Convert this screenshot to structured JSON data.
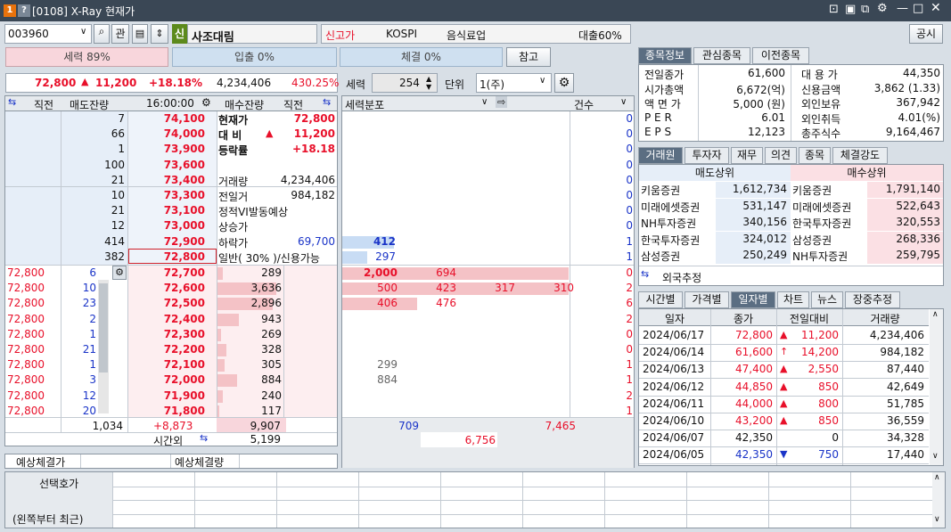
{
  "window": {
    "badge1": "1",
    "badge2": "?",
    "title": "[0108] X-Ray 현재가"
  },
  "toolbar": {
    "code": "003960",
    "gwan": "관",
    "sin": "신",
    "name": "사조대림",
    "flag": "신고가",
    "market": "KOSPI",
    "sector": "음식료업",
    "loan": "대출60%",
    "notice": "공시"
  },
  "strength": {
    "power": "세력 89%",
    "inflow": "입출 0%",
    "exec": "체결 0%",
    "ref": "참고"
  },
  "price_line": {
    "price": "72,800",
    "change": "11,200",
    "rate": "+18.18%",
    "volume": "4,234,406",
    "pct": "430.25%"
  },
  "hoga_head": {
    "c1": "직전",
    "c2": "매도잔량",
    "time": "16:00:00",
    "c4": "매수잔량",
    "c5": "직전"
  },
  "ask": [
    {
      "qty": "7",
      "price": "74,100"
    },
    {
      "qty": "66",
      "price": "74,000"
    },
    {
      "qty": "1",
      "price": "73,900"
    },
    {
      "qty": "100",
      "price": "73,600"
    },
    {
      "qty": "21",
      "price": "73,400"
    },
    {
      "qty": "10",
      "price": "73,300"
    },
    {
      "qty": "21",
      "price": "73,100"
    },
    {
      "qty": "12",
      "price": "73,000"
    },
    {
      "qty": "414",
      "price": "72,900"
    },
    {
      "qty": "382",
      "price": "72,800"
    }
  ],
  "info": [
    {
      "k": "현재가",
      "v": "72,800"
    },
    {
      "k": "대 비",
      "v": "11,200"
    },
    {
      "k": "등락률",
      "v": "+18.18"
    },
    {
      "k": "",
      "v": ""
    },
    {
      "k": "거래량",
      "v": "4,234,406"
    },
    {
      "k": "전일거",
      "v": "984,182"
    },
    {
      "k": "정적VI발동예상",
      "v": ""
    },
    {
      "k": "상승가",
      "v": ""
    },
    {
      "k": "하락가",
      "v": "69,700"
    },
    {
      "k": "일반( 30% )/신용가능",
      "v": ""
    }
  ],
  "bid": [
    {
      "prev": "72,800",
      "exec": "6",
      "price": "72,700",
      "qty": "289"
    },
    {
      "prev": "72,800",
      "exec": "10",
      "price": "72,600",
      "qty": "3,636"
    },
    {
      "prev": "72,800",
      "exec": "23",
      "price": "72,500",
      "qty": "2,896"
    },
    {
      "prev": "72,800",
      "exec": "2",
      "price": "72,400",
      "qty": "943"
    },
    {
      "prev": "72,800",
      "exec": "1",
      "price": "72,300",
      "qty": "269"
    },
    {
      "prev": "72,800",
      "exec": "21",
      "price": "72,200",
      "qty": "328"
    },
    {
      "prev": "72,800",
      "exec": "1",
      "price": "72,100",
      "qty": "305"
    },
    {
      "prev": "72,800",
      "exec": "3",
      "price": "72,000",
      "qty": "884"
    },
    {
      "prev": "72,800",
      "exec": "12",
      "price": "71,900",
      "qty": "240"
    },
    {
      "prev": "72,800",
      "exec": "20",
      "price": "71,800",
      "qty": "117"
    }
  ],
  "totals": {
    "ask_total": "1,034",
    "diff": "+8,873",
    "bid_total": "9,907",
    "after": "시간외",
    "after_val": "5,199"
  },
  "expect": {
    "price_lbl": "예상체결가",
    "vol_lbl": "예상체결량"
  },
  "dist": {
    "head": "세력분포",
    "count": "건수",
    "ask_vals": [
      "412",
      "297"
    ],
    "ask_counts": [
      "0",
      "0",
      "0",
      "0",
      "0",
      "0",
      "0",
      "0",
      "1",
      "1"
    ],
    "bid_rows": [
      [
        "2,000",
        "694",
        "",
        ""
      ],
      [
        "500",
        "423",
        "317",
        "310"
      ],
      [
        "406",
        "476",
        "",
        ""
      ],
      [
        "",
        "",
        "",
        ""
      ],
      [
        "",
        "",
        "",
        ""
      ],
      [
        "",
        "",
        "",
        ""
      ],
      [
        "299",
        "",
        "",
        ""
      ],
      [
        "884",
        "",
        "",
        ""
      ],
      [
        "",
        "",
        "",
        ""
      ],
      [
        "",
        "",
        "",
        ""
      ]
    ],
    "bid_counts": [
      "0",
      "2",
      "6",
      "2",
      "0",
      "0",
      "1",
      "1",
      "2",
      "1"
    ],
    "sum1": "709",
    "sum2": "7,465",
    "sum3": "6,756"
  },
  "order": {
    "lbl1": "선택호가",
    "lbl2": "(왼쪽부터 최근)"
  },
  "stock_tabs": [
    "종목정보",
    "관심종목",
    "이전종목"
  ],
  "stock_info": [
    {
      "k": "전일종가",
      "v": "61,600",
      "k2": "대 용 가",
      "v2": "44,350"
    },
    {
      "k": "시가총액",
      "v": "6,672(억)",
      "k2": "신용금액",
      "v2": "3,862  (1.33)"
    },
    {
      "k": "액 면 가",
      "v": "5,000 (원)",
      "k2": "외인보유",
      "v2": "367,942"
    },
    {
      "k": "P E R",
      "v": "6.01",
      "k2": "외인취득",
      "v2": "4.01(%)"
    },
    {
      "k": "E P S",
      "v": "12,123",
      "k2": "총주식수",
      "v2": "9,164,467"
    }
  ],
  "broker_tabs": [
    "거래원",
    "투자자",
    "재무",
    "의견",
    "종목",
    "체결강도"
  ],
  "broker": {
    "sell_head": "매도상위",
    "buy_head": "매수상위",
    "rows": [
      [
        "키움증권",
        "1,612,734",
        "키움증권",
        "1,791,140"
      ],
      [
        "미래에셋증권",
        "531,147",
        "미래에셋증권",
        "522,643"
      ],
      [
        "NH투자증권",
        "340,156",
        "한국투자증권",
        "320,553"
      ],
      [
        "한국투자증권",
        "324,012",
        "삼성증권",
        "268,336"
      ],
      [
        "삼성증권",
        "250,249",
        "NH투자증권",
        "259,795"
      ]
    ],
    "foreign": "외국추정"
  },
  "daily_tabs": [
    "시간별",
    "가격별",
    "일자별",
    "차트",
    "뉴스",
    "장중추정"
  ],
  "daily_head": [
    "일자",
    "종가",
    "전일대비",
    "거래량"
  ],
  "daily": [
    {
      "d": "2024/06/17",
      "c": "72,800",
      "s": "▲",
      "ch": "11,200",
      "v": "4,234,406",
      "col": "r"
    },
    {
      "d": "2024/06/14",
      "c": "61,600",
      "s": "↑",
      "ch": "14,200",
      "v": "984,182",
      "col": "r"
    },
    {
      "d": "2024/06/13",
      "c": "47,400",
      "s": "▲",
      "ch": "2,550",
      "v": "87,440",
      "col": "r"
    },
    {
      "d": "2024/06/12",
      "c": "44,850",
      "s": "▲",
      "ch": "850",
      "v": "42,649",
      "col": "r"
    },
    {
      "d": "2024/06/11",
      "c": "44,000",
      "s": "▲",
      "ch": "800",
      "v": "51,785",
      "col": "r"
    },
    {
      "d": "2024/06/10",
      "c": "43,200",
      "s": "▲",
      "ch": "850",
      "v": "36,559",
      "col": "r"
    },
    {
      "d": "2024/06/07",
      "c": "42,350",
      "s": "",
      "ch": "0",
      "v": "34,328",
      "col": ""
    },
    {
      "d": "2024/06/05",
      "c": "42,350",
      "s": "▼",
      "ch": "750",
      "v": "17,440",
      "col": "b"
    }
  ]
}
